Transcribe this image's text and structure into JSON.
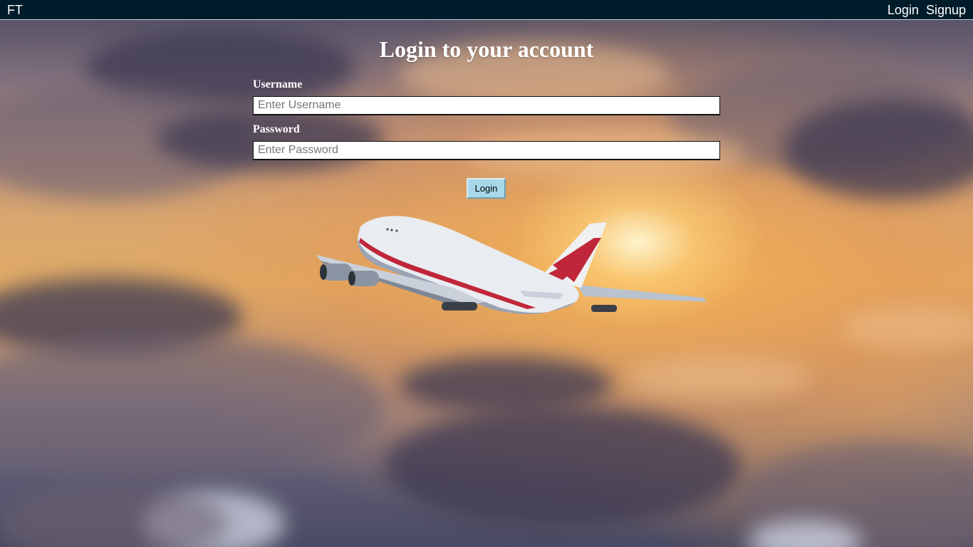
{
  "navbar": {
    "brand": "FT",
    "links": [
      {
        "label": "Login"
      },
      {
        "label": "Signup"
      }
    ]
  },
  "login_form": {
    "title": "Login to your account",
    "username": {
      "label": "Username",
      "placeholder": "Enter Username",
      "value": ""
    },
    "password": {
      "label": "Password",
      "placeholder": "Enter Password",
      "value": ""
    },
    "submit_label": "Login"
  },
  "colors": {
    "navbar_bg": "#001c2a",
    "button_bg": "#a7d8e9",
    "text_on_background": "#ffffff",
    "airplane_stripe": "#c0263a"
  }
}
